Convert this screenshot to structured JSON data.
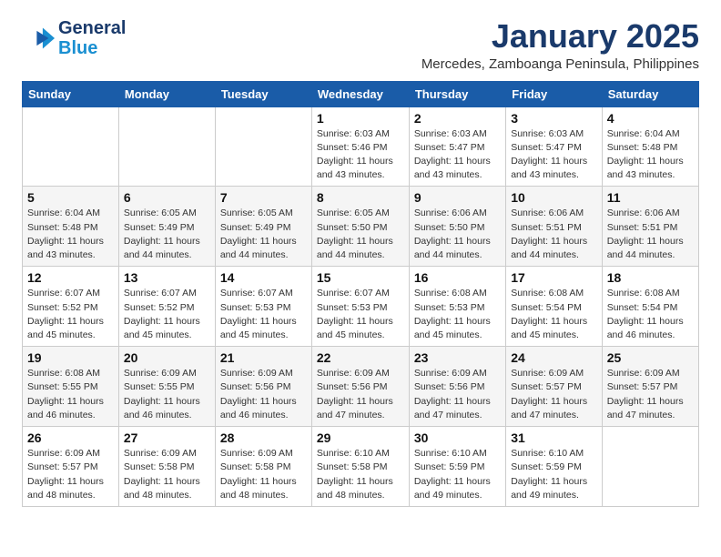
{
  "logo": {
    "general": "General",
    "blue": "Blue"
  },
  "header": {
    "month": "January 2025",
    "location": "Mercedes, Zamboanga Peninsula, Philippines"
  },
  "days_of_week": [
    "Sunday",
    "Monday",
    "Tuesday",
    "Wednesday",
    "Thursday",
    "Friday",
    "Saturday"
  ],
  "weeks": [
    [
      {
        "day": "",
        "info": ""
      },
      {
        "day": "",
        "info": ""
      },
      {
        "day": "",
        "info": ""
      },
      {
        "day": "1",
        "info": "Sunrise: 6:03 AM\nSunset: 5:46 PM\nDaylight: 11 hours and 43 minutes."
      },
      {
        "day": "2",
        "info": "Sunrise: 6:03 AM\nSunset: 5:47 PM\nDaylight: 11 hours and 43 minutes."
      },
      {
        "day": "3",
        "info": "Sunrise: 6:03 AM\nSunset: 5:47 PM\nDaylight: 11 hours and 43 minutes."
      },
      {
        "day": "4",
        "info": "Sunrise: 6:04 AM\nSunset: 5:48 PM\nDaylight: 11 hours and 43 minutes."
      }
    ],
    [
      {
        "day": "5",
        "info": "Sunrise: 6:04 AM\nSunset: 5:48 PM\nDaylight: 11 hours and 43 minutes."
      },
      {
        "day": "6",
        "info": "Sunrise: 6:05 AM\nSunset: 5:49 PM\nDaylight: 11 hours and 44 minutes."
      },
      {
        "day": "7",
        "info": "Sunrise: 6:05 AM\nSunset: 5:49 PM\nDaylight: 11 hours and 44 minutes."
      },
      {
        "day": "8",
        "info": "Sunrise: 6:05 AM\nSunset: 5:50 PM\nDaylight: 11 hours and 44 minutes."
      },
      {
        "day": "9",
        "info": "Sunrise: 6:06 AM\nSunset: 5:50 PM\nDaylight: 11 hours and 44 minutes."
      },
      {
        "day": "10",
        "info": "Sunrise: 6:06 AM\nSunset: 5:51 PM\nDaylight: 11 hours and 44 minutes."
      },
      {
        "day": "11",
        "info": "Sunrise: 6:06 AM\nSunset: 5:51 PM\nDaylight: 11 hours and 44 minutes."
      }
    ],
    [
      {
        "day": "12",
        "info": "Sunrise: 6:07 AM\nSunset: 5:52 PM\nDaylight: 11 hours and 45 minutes."
      },
      {
        "day": "13",
        "info": "Sunrise: 6:07 AM\nSunset: 5:52 PM\nDaylight: 11 hours and 45 minutes."
      },
      {
        "day": "14",
        "info": "Sunrise: 6:07 AM\nSunset: 5:53 PM\nDaylight: 11 hours and 45 minutes."
      },
      {
        "day": "15",
        "info": "Sunrise: 6:07 AM\nSunset: 5:53 PM\nDaylight: 11 hours and 45 minutes."
      },
      {
        "day": "16",
        "info": "Sunrise: 6:08 AM\nSunset: 5:53 PM\nDaylight: 11 hours and 45 minutes."
      },
      {
        "day": "17",
        "info": "Sunrise: 6:08 AM\nSunset: 5:54 PM\nDaylight: 11 hours and 45 minutes."
      },
      {
        "day": "18",
        "info": "Sunrise: 6:08 AM\nSunset: 5:54 PM\nDaylight: 11 hours and 46 minutes."
      }
    ],
    [
      {
        "day": "19",
        "info": "Sunrise: 6:08 AM\nSunset: 5:55 PM\nDaylight: 11 hours and 46 minutes."
      },
      {
        "day": "20",
        "info": "Sunrise: 6:09 AM\nSunset: 5:55 PM\nDaylight: 11 hours and 46 minutes."
      },
      {
        "day": "21",
        "info": "Sunrise: 6:09 AM\nSunset: 5:56 PM\nDaylight: 11 hours and 46 minutes."
      },
      {
        "day": "22",
        "info": "Sunrise: 6:09 AM\nSunset: 5:56 PM\nDaylight: 11 hours and 47 minutes."
      },
      {
        "day": "23",
        "info": "Sunrise: 6:09 AM\nSunset: 5:56 PM\nDaylight: 11 hours and 47 minutes."
      },
      {
        "day": "24",
        "info": "Sunrise: 6:09 AM\nSunset: 5:57 PM\nDaylight: 11 hours and 47 minutes."
      },
      {
        "day": "25",
        "info": "Sunrise: 6:09 AM\nSunset: 5:57 PM\nDaylight: 11 hours and 47 minutes."
      }
    ],
    [
      {
        "day": "26",
        "info": "Sunrise: 6:09 AM\nSunset: 5:57 PM\nDaylight: 11 hours and 48 minutes."
      },
      {
        "day": "27",
        "info": "Sunrise: 6:09 AM\nSunset: 5:58 PM\nDaylight: 11 hours and 48 minutes."
      },
      {
        "day": "28",
        "info": "Sunrise: 6:09 AM\nSunset: 5:58 PM\nDaylight: 11 hours and 48 minutes."
      },
      {
        "day": "29",
        "info": "Sunrise: 6:10 AM\nSunset: 5:58 PM\nDaylight: 11 hours and 48 minutes."
      },
      {
        "day": "30",
        "info": "Sunrise: 6:10 AM\nSunset: 5:59 PM\nDaylight: 11 hours and 49 minutes."
      },
      {
        "day": "31",
        "info": "Sunrise: 6:10 AM\nSunset: 5:59 PM\nDaylight: 11 hours and 49 minutes."
      },
      {
        "day": "",
        "info": ""
      }
    ]
  ]
}
